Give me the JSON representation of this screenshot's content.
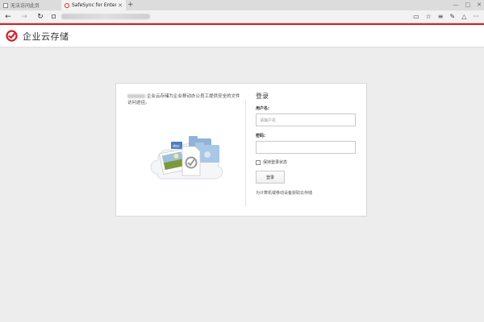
{
  "browser": {
    "tabs": [
      {
        "label": "无法访问此页"
      },
      {
        "label": "SafeSync for Enterprise"
      }
    ],
    "new_tab": "+",
    "window_controls": [
      "—",
      "□",
      "✕"
    ],
    "nav": {
      "back": "←",
      "forward": "→",
      "refresh": "↻"
    },
    "right_icons": [
      "▭",
      "☆",
      "≡",
      "✎",
      "△",
      "···"
    ]
  },
  "app": {
    "title": "企业云存储",
    "brand_color": "#d2232a"
  },
  "card": {
    "intro": "企业云存储为企业移动办公员工提供安全的文件访问途径。",
    "login": {
      "title": "登录",
      "username_label": "用户名:",
      "username_placeholder": "请输户名",
      "password_label": "密码:",
      "password_placeholder": "",
      "remember_label": "保持登录状态",
      "button_label": "登录",
      "mobile_link": "为计算机或移动设备获取云存储"
    }
  },
  "icons": {
    "back": "back-arrow-icon",
    "forward": "forward-arrow-icon",
    "refresh": "refresh-icon",
    "lock": "lock-icon",
    "reading": "reading-view-icon",
    "favorite": "star-icon",
    "hub": "hub-icon",
    "note": "web-note-icon",
    "share": "share-icon",
    "more": "more-icon",
    "logo": "safesync-logo-icon"
  }
}
